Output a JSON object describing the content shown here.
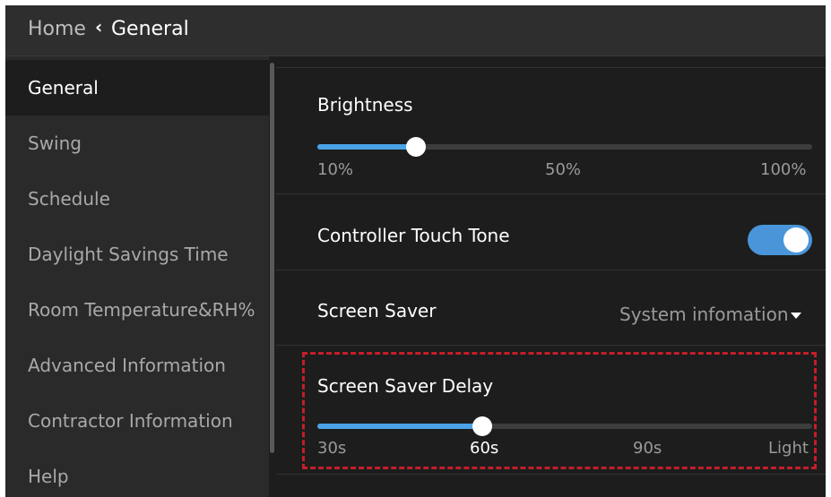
{
  "header": {
    "home_label": "Home",
    "back_icon": "chevron-left-icon",
    "current_label": "General"
  },
  "sidebar": {
    "items": [
      {
        "label": "General",
        "active": true
      },
      {
        "label": "Swing",
        "active": false
      },
      {
        "label": "Schedule",
        "active": false
      },
      {
        "label": "Daylight Savings Time",
        "active": false
      },
      {
        "label": "Room Temperature&RH%",
        "active": false
      },
      {
        "label": "Advanced Information",
        "active": false
      },
      {
        "label": "Contractor Information",
        "active": false
      },
      {
        "label": "Help",
        "active": false
      }
    ]
  },
  "settings": {
    "brightness": {
      "label": "Brightness",
      "ticks": [
        "10%",
        "50%",
        "100%"
      ],
      "value_fraction": 0.2
    },
    "touch_tone": {
      "label": "Controller Touch Tone",
      "enabled": true
    },
    "screen_saver": {
      "label": "Screen Saver",
      "value": "System infomation",
      "caret_icon": "caret-down-icon"
    },
    "screen_saver_delay": {
      "label": "Screen Saver Delay",
      "ticks": [
        "30s",
        "60s",
        "90s",
        "Light"
      ],
      "selected": "60s",
      "value_fraction": 0.333
    }
  },
  "colors": {
    "accent": "#4aa3e6",
    "toggle_on": "#4a95d9",
    "highlight_border": "#c41e2a",
    "background": "#1d1d1d",
    "sidebar": "#2a2a2a",
    "topbar": "#2e2e2e"
  }
}
